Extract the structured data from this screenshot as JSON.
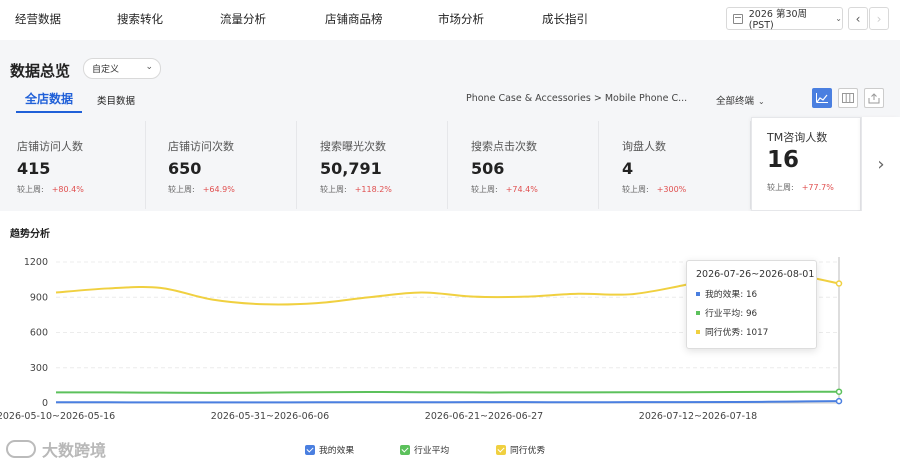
{
  "nav": {
    "items": [
      "经营数据",
      "搜索转化",
      "流量分析",
      "店铺商品榜",
      "市场分析",
      "成长指引"
    ],
    "week": "2026 第30周 (PST)",
    "prev": "‹",
    "next": "›"
  },
  "header": {
    "title": "数据总览",
    "range_select": "自定义",
    "tabs": [
      "全店数据",
      "类目数据"
    ],
    "active_tab": "全店数据",
    "category": "Phone Case & Accessories > Mobile Phone C...",
    "terminal": "全部终端",
    "views": [
      "line-chart-icon",
      "table-icon",
      "export-icon"
    ]
  },
  "metrics": [
    {
      "label": "店铺访问人数",
      "value": "415",
      "compare_label": "较上周:",
      "delta": "+80.4%"
    },
    {
      "label": "店铺访问次数",
      "value": "650",
      "compare_label": "较上周:",
      "delta": "+64.9%"
    },
    {
      "label": "搜索曝光次数",
      "value": "50,791",
      "compare_label": "较上周:",
      "delta": "+118.2%"
    },
    {
      "label": "搜索点击次数",
      "value": "506",
      "compare_label": "较上周:",
      "delta": "+74.4%"
    },
    {
      "label": "询盘人数",
      "value": "4",
      "compare_label": "较上周:",
      "delta": "+300%"
    },
    {
      "label": "TM咨询人数",
      "value": "16",
      "compare_label": "较上周:",
      "delta": "+77.7%"
    }
  ],
  "trend": {
    "title": "趋势分析",
    "tooltip": {
      "title": "2026-07-26~2026-08-01",
      "rows": [
        "我的效果: 16",
        "行业平均: 96",
        "同行优秀: 1017"
      ]
    }
  },
  "watermark": "大数跨境",
  "colors": {
    "accent": "#2060d8",
    "mine": "#4a7fe0",
    "industry": "#5cc15c",
    "top": "#f0d040",
    "delta": "#e05050"
  },
  "chart_data": {
    "type": "line",
    "x_labels_shown": [
      "2026-05-10~2026-05-16",
      "2026-05-31~2026-06-06",
      "2026-06-21~2026-06-27",
      "2026-07-12~2026-07-18"
    ],
    "ylim": [
      0,
      1200
    ],
    "yticks": [
      0,
      300,
      600,
      900,
      1200
    ],
    "grid": true,
    "legend_position": "bottom",
    "series": [
      {
        "name": "我的效果",
        "color": "#4a7fe0",
        "values": [
          6,
          6,
          5,
          5,
          5,
          6,
          6,
          6,
          7,
          7,
          6,
          7,
          7,
          8,
          12,
          16
        ]
      },
      {
        "name": "行业平均",
        "color": "#5cc15c",
        "values": [
          90,
          90,
          88,
          86,
          88,
          92,
          94,
          92,
          90,
          90,
          90,
          91,
          92,
          94,
          95,
          96
        ]
      },
      {
        "name": "同行优秀",
        "color": "#f0d040",
        "values": [
          940,
          975,
          980,
          880,
          840,
          850,
          900,
          940,
          905,
          905,
          930,
          925,
          1000,
          1095,
          1100,
          1017
        ]
      }
    ]
  }
}
